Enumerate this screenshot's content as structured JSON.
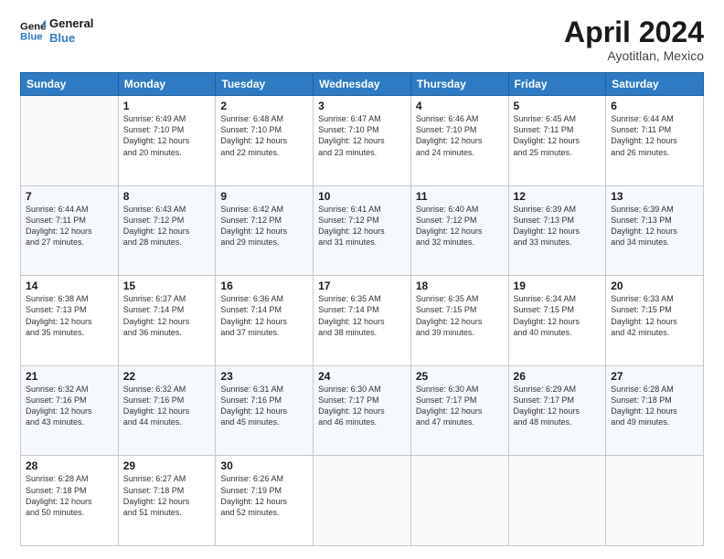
{
  "header": {
    "logo_line1": "General",
    "logo_line2": "Blue",
    "month_title": "April 2024",
    "location": "Ayotitlan, Mexico"
  },
  "weekdays": [
    "Sunday",
    "Monday",
    "Tuesday",
    "Wednesday",
    "Thursday",
    "Friday",
    "Saturday"
  ],
  "weeks": [
    [
      {
        "day": "",
        "info": ""
      },
      {
        "day": "1",
        "info": "Sunrise: 6:49 AM\nSunset: 7:10 PM\nDaylight: 12 hours\nand 20 minutes."
      },
      {
        "day": "2",
        "info": "Sunrise: 6:48 AM\nSunset: 7:10 PM\nDaylight: 12 hours\nand 22 minutes."
      },
      {
        "day": "3",
        "info": "Sunrise: 6:47 AM\nSunset: 7:10 PM\nDaylight: 12 hours\nand 23 minutes."
      },
      {
        "day": "4",
        "info": "Sunrise: 6:46 AM\nSunset: 7:10 PM\nDaylight: 12 hours\nand 24 minutes."
      },
      {
        "day": "5",
        "info": "Sunrise: 6:45 AM\nSunset: 7:11 PM\nDaylight: 12 hours\nand 25 minutes."
      },
      {
        "day": "6",
        "info": "Sunrise: 6:44 AM\nSunset: 7:11 PM\nDaylight: 12 hours\nand 26 minutes."
      }
    ],
    [
      {
        "day": "7",
        "info": "Sunrise: 6:44 AM\nSunset: 7:11 PM\nDaylight: 12 hours\nand 27 minutes."
      },
      {
        "day": "8",
        "info": "Sunrise: 6:43 AM\nSunset: 7:12 PM\nDaylight: 12 hours\nand 28 minutes."
      },
      {
        "day": "9",
        "info": "Sunrise: 6:42 AM\nSunset: 7:12 PM\nDaylight: 12 hours\nand 29 minutes."
      },
      {
        "day": "10",
        "info": "Sunrise: 6:41 AM\nSunset: 7:12 PM\nDaylight: 12 hours\nand 31 minutes."
      },
      {
        "day": "11",
        "info": "Sunrise: 6:40 AM\nSunset: 7:12 PM\nDaylight: 12 hours\nand 32 minutes."
      },
      {
        "day": "12",
        "info": "Sunrise: 6:39 AM\nSunset: 7:13 PM\nDaylight: 12 hours\nand 33 minutes."
      },
      {
        "day": "13",
        "info": "Sunrise: 6:39 AM\nSunset: 7:13 PM\nDaylight: 12 hours\nand 34 minutes."
      }
    ],
    [
      {
        "day": "14",
        "info": "Sunrise: 6:38 AM\nSunset: 7:13 PM\nDaylight: 12 hours\nand 35 minutes."
      },
      {
        "day": "15",
        "info": "Sunrise: 6:37 AM\nSunset: 7:14 PM\nDaylight: 12 hours\nand 36 minutes."
      },
      {
        "day": "16",
        "info": "Sunrise: 6:36 AM\nSunset: 7:14 PM\nDaylight: 12 hours\nand 37 minutes."
      },
      {
        "day": "17",
        "info": "Sunrise: 6:35 AM\nSunset: 7:14 PM\nDaylight: 12 hours\nand 38 minutes."
      },
      {
        "day": "18",
        "info": "Sunrise: 6:35 AM\nSunset: 7:15 PM\nDaylight: 12 hours\nand 39 minutes."
      },
      {
        "day": "19",
        "info": "Sunrise: 6:34 AM\nSunset: 7:15 PM\nDaylight: 12 hours\nand 40 minutes."
      },
      {
        "day": "20",
        "info": "Sunrise: 6:33 AM\nSunset: 7:15 PM\nDaylight: 12 hours\nand 42 minutes."
      }
    ],
    [
      {
        "day": "21",
        "info": "Sunrise: 6:32 AM\nSunset: 7:16 PM\nDaylight: 12 hours\nand 43 minutes."
      },
      {
        "day": "22",
        "info": "Sunrise: 6:32 AM\nSunset: 7:16 PM\nDaylight: 12 hours\nand 44 minutes."
      },
      {
        "day": "23",
        "info": "Sunrise: 6:31 AM\nSunset: 7:16 PM\nDaylight: 12 hours\nand 45 minutes."
      },
      {
        "day": "24",
        "info": "Sunrise: 6:30 AM\nSunset: 7:17 PM\nDaylight: 12 hours\nand 46 minutes."
      },
      {
        "day": "25",
        "info": "Sunrise: 6:30 AM\nSunset: 7:17 PM\nDaylight: 12 hours\nand 47 minutes."
      },
      {
        "day": "26",
        "info": "Sunrise: 6:29 AM\nSunset: 7:17 PM\nDaylight: 12 hours\nand 48 minutes."
      },
      {
        "day": "27",
        "info": "Sunrise: 6:28 AM\nSunset: 7:18 PM\nDaylight: 12 hours\nand 49 minutes."
      }
    ],
    [
      {
        "day": "28",
        "info": "Sunrise: 6:28 AM\nSunset: 7:18 PM\nDaylight: 12 hours\nand 50 minutes."
      },
      {
        "day": "29",
        "info": "Sunrise: 6:27 AM\nSunset: 7:18 PM\nDaylight: 12 hours\nand 51 minutes."
      },
      {
        "day": "30",
        "info": "Sunrise: 6:26 AM\nSunset: 7:19 PM\nDaylight: 12 hours\nand 52 minutes."
      },
      {
        "day": "",
        "info": ""
      },
      {
        "day": "",
        "info": ""
      },
      {
        "day": "",
        "info": ""
      },
      {
        "day": "",
        "info": ""
      }
    ]
  ]
}
